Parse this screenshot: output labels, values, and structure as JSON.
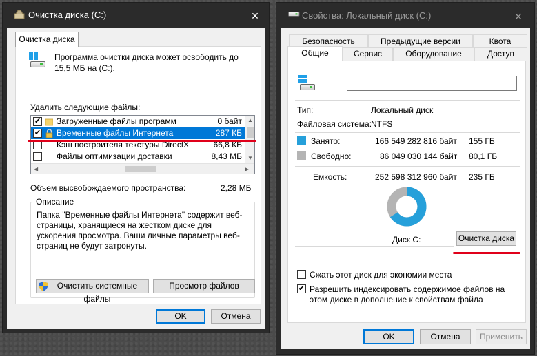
{
  "window1": {
    "title": "Очистка диска  (C:)",
    "close_glyph": "✕",
    "tab": "Очистка диска",
    "intro": "Программа очистки диска может освободить до 15,5 МБ на  (C:).",
    "files_label": "Удалить следующие файлы:",
    "files": [
      {
        "name": "Загруженные файлы программ",
        "size": "0 байт",
        "checked": true,
        "selected": false,
        "icon": "folder-icon"
      },
      {
        "name": "Временные файлы Интернета",
        "size": "287 КБ",
        "checked": true,
        "selected": true,
        "icon": "lock-icon"
      },
      {
        "name": "Кэш построителя текстуры DirectX",
        "size": "66,8 КБ",
        "checked": false,
        "selected": false,
        "icon": "blank-file-icon"
      },
      {
        "name": "Файлы оптимизации доставки",
        "size": "8,43 МБ",
        "checked": false,
        "selected": false,
        "icon": "blank-file-icon"
      }
    ],
    "space_label": "Объем высвобождаемого пространства:",
    "space_value": "2,28 МБ",
    "desc_title": "Описание",
    "desc_text": "Папка \"Временные файлы Интернета\" содержит веб-страницы, хранящиеся на жестком диске для ускорения просмотра. Ваши личные параметры веб-страниц не будут затронуты.",
    "clean_system_button": "Очистить системные файлы",
    "view_files_button": "Просмотр файлов",
    "ok_button": "OK",
    "cancel_button": "Отмена",
    "annotation_color": "#e0001a"
  },
  "window2": {
    "title": "Свойства: Локальный диск (C:)",
    "close_glyph": "✕",
    "tabs_row1": [
      "Безопасность",
      "Предыдущие версии",
      "Квота"
    ],
    "tabs_row2": [
      "Общие",
      "Сервис",
      "Оборудование",
      "Доступ"
    ],
    "active_tab": "Общие",
    "volume_name": "",
    "type_label": "Тип:",
    "type_value": "Локальный диск",
    "fs_label": "Файловая система:",
    "fs_value": "NTFS",
    "used_label": "Занято:",
    "used_bytes": "166 549 282 816 байт",
    "used_size": "155 ГБ",
    "used_color": "#26a0da",
    "free_label": "Свободно:",
    "free_bytes": "86 049 030 144 байт",
    "free_size": "80,1 ГБ",
    "free_color": "#b4b4b4",
    "capacity_label": "Емкость:",
    "capacity_bytes": "252 598 312 960 байт",
    "capacity_size": "235 ГБ",
    "used_fraction": 0.659,
    "disk_label": "Диск C:",
    "cleanup_button": "Очистка диска",
    "compress_label": "Сжать этот диск для экономии места",
    "compress_checked": false,
    "index_label": "Разрешить индексировать содержимое файлов на этом диске в дополнение к свойствам файла",
    "index_checked": true,
    "ok_button": "OK",
    "cancel_button": "Отмена",
    "apply_button": "Применить"
  }
}
